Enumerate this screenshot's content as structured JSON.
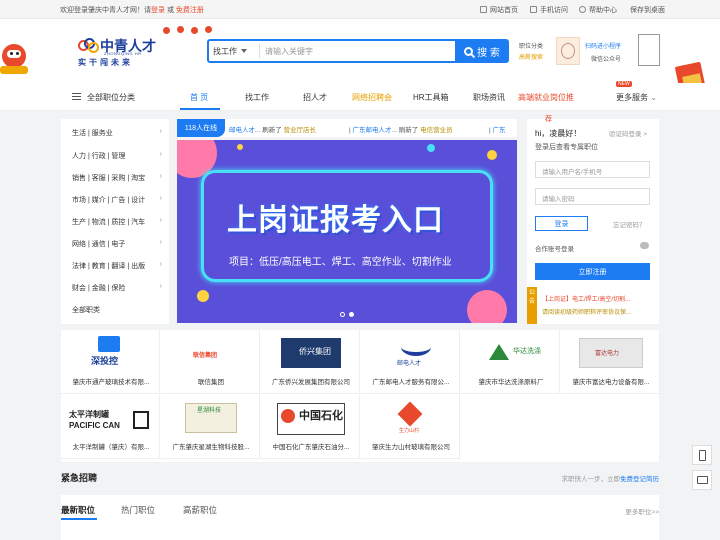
{
  "topbar": {
    "welcome_prefix": "欢迎登录肇庆中青人才网！请",
    "login": "登录",
    "or": "或",
    "register": "免费注册",
    "links": [
      "网站首页",
      "手机访问",
      "帮助中心",
      "保存到桌面"
    ]
  },
  "logo": {
    "cn": "中青人才",
    "en": "ZHONGQING HR",
    "slogan": "实干闯未来"
  },
  "search": {
    "type": "找工作",
    "placeholder": "请输入关键字",
    "button": "搜 索"
  },
  "header_right": {
    "cat_label": "职位分类",
    "gaoxin": "高薪搜索",
    "miniprog": "扫码进小程序",
    "wechat": "微信公众号"
  },
  "nav": {
    "all_categories": "全部职位分类",
    "items": [
      "首 页",
      "找工作",
      "招人才",
      "网络招聘会",
      "HR工具箱",
      "职场资讯",
      "高端就业岗位推",
      "更多服务"
    ],
    "new_badge": "NEW"
  },
  "categories": [
    "生活 | 服务业",
    "人力 | 行政 | 管理",
    "销售 | 客服 | 采购 | 淘宝",
    "市场 | 媒介 | 广告 | 设计",
    "生产 | 物流 | 质控 | 汽车",
    "网络 | 通信 | 电子",
    "法律 | 教育 | 翻译 | 出版",
    "财会 | 金融 | 保险",
    "全部职类"
  ],
  "ticker": {
    "online": "118人在线",
    "items": [
      {
        "a": "邮电人才...",
        "b": "刷新了",
        "c": "营业厅店长"
      },
      {
        "a": "广东邮电人才...",
        "b": "刷新了",
        "c": "电信营业员"
      },
      {
        "a": "广东",
        "b": "",
        "c": ""
      }
    ]
  },
  "banner": {
    "title": "上岗证报考入口",
    "subtitle": "项目：低压/高压电工、焊工、高空作业、切割作业"
  },
  "login": {
    "hi": "hi，凌晨好！",
    "code_login": "验证码登录 >",
    "desc": "登录后查看专属职位",
    "user_placeholder": "请输入用户名/手机号",
    "pass_placeholder": "请输入密码",
    "login_btn": "登录",
    "forgot": "忘记密码？",
    "partner": "合作账号登录",
    "register_btn": "立即注册",
    "recommend": "荐",
    "notice_tag": "公告",
    "notice1": "【上岗证】电工/焊工/高空/切割...",
    "notice2": "请阅读初级药师职称评审协议保..."
  },
  "companies": [
    {
      "name": "肇庆市通产玻璃技术有限...",
      "logo": "深投控"
    },
    {
      "name": "联信集团",
      "logo": "联信集团"
    },
    {
      "name": "广东侨兴发展集团有限公司",
      "logo": "侨兴集团"
    },
    {
      "name": "广东邮电人才服务有限公...",
      "logo": "邮电人才"
    },
    {
      "name": "肇庆市华达洗涤原料厂",
      "logo": "华达洗涤"
    },
    {
      "name": "肇庆市富达电力设备有限...",
      "logo": "富达电力"
    },
    {
      "name": "太平洋制罐（肇庆）有限...",
      "logo": "太平洋制罐 PACIFIC CAN"
    },
    {
      "name": "广东肇庆星湖生物科技股...",
      "logo": "星湖科技"
    },
    {
      "name": "中国石化广东肇庆石油分...",
      "logo": "中国石化"
    },
    {
      "name": "肇庆生力山村玻璃有限公司",
      "logo": "生力山村"
    }
  ],
  "urgent": {
    "title": "紧急招聘",
    "right_prefix": "求职快人一步，立即",
    "right_link": "免费登记简历"
  },
  "jobtabs": {
    "items": [
      "最新职位",
      "热门职位",
      "高薪职位"
    ],
    "more": "更多职位>>"
  },
  "colors": {
    "primary": "#1d7cf2",
    "red": "#e8482b",
    "banner": "#5a4fd8"
  }
}
